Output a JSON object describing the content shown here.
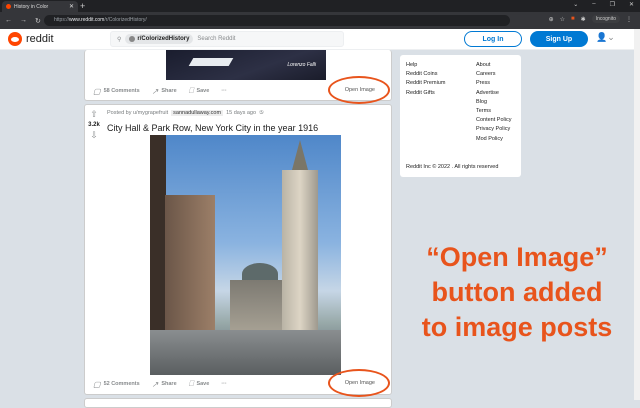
{
  "browser": {
    "tab_title": "History in Color",
    "url_prefix": "https://",
    "url_domain": "www.reddit.com",
    "url_path": "/r/ColorizedHistory/",
    "profile": "Incognito"
  },
  "header": {
    "logo": "reddit",
    "community": "r/ColorizedHistory",
    "search_placeholder": "Search Reddit",
    "login": "Log In",
    "signup": "Sign Up"
  },
  "posts": [
    {
      "comments": "58 Comments",
      "share": "Share",
      "save": "Save",
      "more": "···",
      "open_image": "Open Image",
      "signature": "Lorenzo Falli"
    },
    {
      "score": "3.2k",
      "posted_by": "Posted by u/mygrapefruit",
      "domain": "sannadullaway.com",
      "age": "15 days ago",
      "title": "City Hall & Park Row, New York City in the year 1916",
      "comments": "52 Comments",
      "share": "Share",
      "save": "Save",
      "more": "···",
      "open_image": "Open Image"
    }
  ],
  "sidebar": {
    "col1": [
      "Help",
      "Reddit Coins",
      "Reddit Premium",
      "Reddit Gifts"
    ],
    "col2": [
      "About",
      "Careers",
      "Press",
      "Advertise",
      "Blog",
      "Terms",
      "Content Policy",
      "Privacy Policy",
      "Mod Policy"
    ],
    "copyright": "Reddit Inc © 2022 . All rights reserved"
  },
  "annotation": [
    "“Open Image”",
    "button added",
    "to image posts"
  ]
}
